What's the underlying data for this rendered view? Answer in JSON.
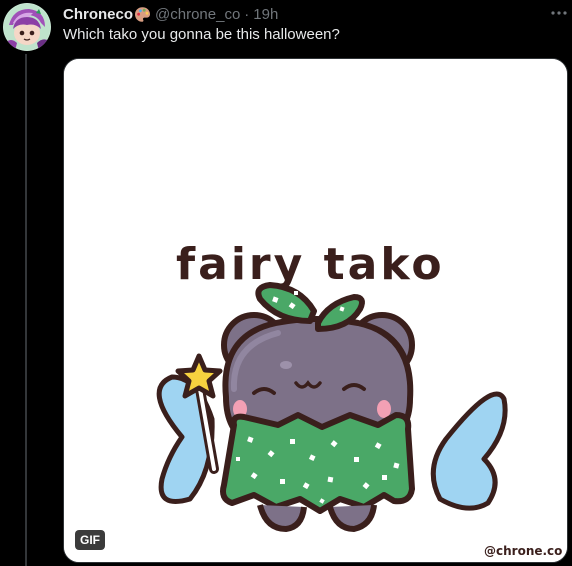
{
  "tweet": {
    "display_name": "Chroneco",
    "name_emoji": "artist-palette-emoji",
    "handle": "@chrone_co",
    "separator": "·",
    "time": "19h",
    "text": "Which tako you gonna be this halloween?",
    "more_icon": "more-horizontal-icon"
  },
  "media": {
    "badge": "GIF",
    "artwork_text": "fairy tako",
    "watermark": "@chrone.co"
  },
  "colors": {
    "background": "#000000",
    "text_primary": "#e7e9ea",
    "text_secondary": "#71767b",
    "thread_line": "#333639",
    "art_outline": "#3a1f1c",
    "tako_body": "#7d7188",
    "tako_cloak": "#4aa867",
    "wing": "#9fd4f2",
    "star": "#f6d23f"
  }
}
